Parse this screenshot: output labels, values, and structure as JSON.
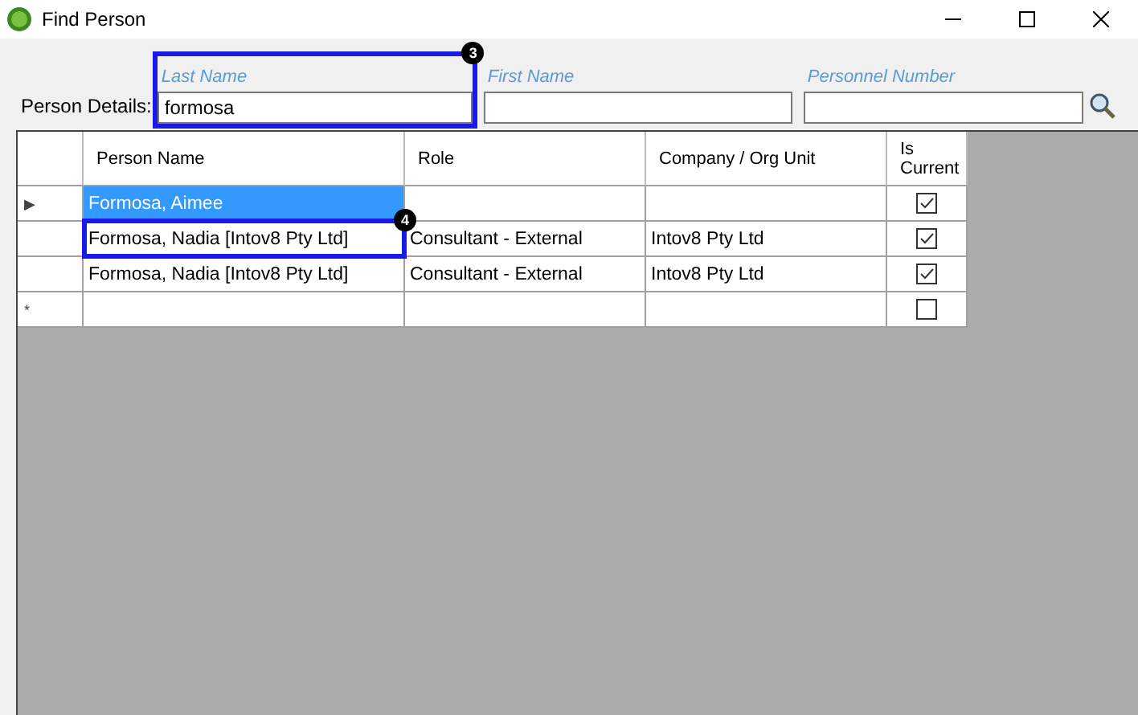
{
  "window": {
    "title": "Find Person"
  },
  "person_details_label": "Person Details:",
  "fields": [
    {
      "label": "Last Name",
      "value": "formosa",
      "callout": "3"
    },
    {
      "label": "First Name"
    },
    {
      "label": "Personnel Number"
    }
  ],
  "grid": {
    "columns": [
      "Person Name",
      "Role",
      "Company / Org Unit",
      "Is Current"
    ],
    "rows": [
      {
        "row_header": "▶",
        "selected": true,
        "cells": [
          "Formosa, Aimee",
          null,
          null
        ],
        "is_current": true
      },
      {
        "selected": false,
        "cells": [
          "Formosa, Nadia [Intov8 Pty Ltd]",
          "Consultant - External",
          "Intov8 Pty Ltd"
        ],
        "is_current": true,
        "callout": "4"
      },
      {
        "selected": false,
        "cells": [
          "Formosa, Nadia [Intov8 Pty Ltd]",
          "Consultant - External",
          "Intov8 Pty Ltd"
        ],
        "is_current": true
      },
      {
        "row_header": "*",
        "selected": false,
        "cells": [
          null,
          null,
          null
        ],
        "is_current": false
      }
    ]
  }
}
